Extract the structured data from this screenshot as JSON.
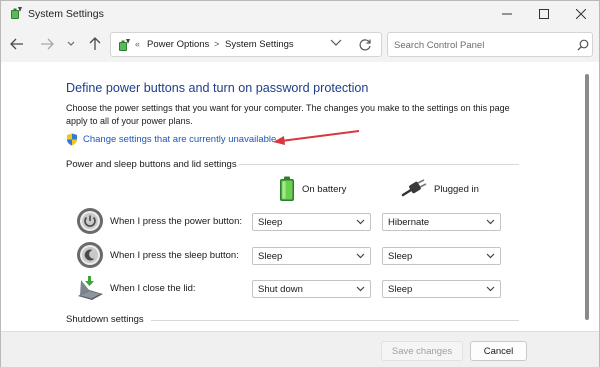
{
  "window": {
    "title": "System Settings"
  },
  "nav": {
    "breadcrumbs": [
      "Power Options",
      "System Settings"
    ],
    "overflow_glyph": "«",
    "separator_glyph": ">",
    "search_placeholder": "Search Control Panel"
  },
  "main": {
    "heading": "Define power buttons and turn on password protection",
    "description": "Choose the power settings that you want for your computer. The changes you make to the settings on this page apply to all of your power plans.",
    "change_link": "Change settings that are currently unavailable",
    "section_title": "Power and sleep buttons and lid settings",
    "columns": {
      "battery": "On battery",
      "plugged": "Plugged in"
    },
    "rows": [
      {
        "label": "When I press the power button:",
        "battery": "Sleep",
        "plugged": "Hibernate",
        "icon": "power-button-icon"
      },
      {
        "label": "When I press the sleep button:",
        "battery": "Sleep",
        "plugged": "Sleep",
        "icon": "sleep-button-icon"
      },
      {
        "label": "When I close the lid:",
        "battery": "Shut down",
        "plugged": "Sleep",
        "icon": "laptop-lid-icon"
      }
    ],
    "shutdown_title": "Shutdown settings"
  },
  "footer": {
    "save_label": "Save changes",
    "cancel_label": "Cancel"
  },
  "colors": {
    "heading": "#1c3f8c",
    "link": "#1e57b8",
    "annotation_arrow": "#d9363e"
  }
}
